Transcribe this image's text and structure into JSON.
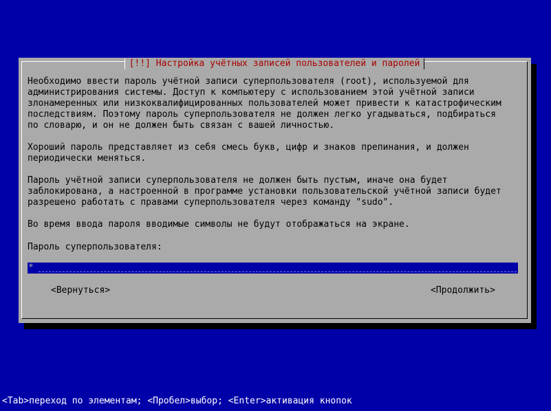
{
  "dialog": {
    "title": "[!!] Настройка учётных записей пользователей и паролей",
    "paragraphs": [
      "Необходимо ввести пароль учётной записи суперпользователя (root), используемой для\nадминистрирования системы. Доступ к компьютеру с использованием этой учётной записи\nзлонамеренных или низкоквалифицированных пользователей может привести к катастрофическим\nпоследствиям. Поэтому пароль суперпользователя не должен легко угадываться, подбираться\nпо словарю, и он не должен быть связан с вашей личностью.",
      "Хороший пароль представляет из себя смесь букв, цифр и знаков препинания, и должен\nпериодически меняться.",
      "Пароль учётной записи суперпользователя не должен быть пустым, иначе она будет\nзаблокирована, а настроенной в программе установки пользовательской учётной записи будет\nразрешено работать с правами суперпользователя через команду \"sudo\".",
      "Во время ввода пароля вводимые символы не будут отображаться на экране."
    ],
    "prompt_label": "Пароль суперпользователя:",
    "input_value": "*",
    "back_button": "<Вернуться>",
    "continue_button": "<Продолжить>"
  },
  "statusbar": {
    "text": "<Tab>переход по элементам; <Пробел>выбор; <Enter>активация кнопок"
  },
  "colors": {
    "background": "#0000a8",
    "dialog": "#aaaaaa",
    "title": "#a80000",
    "input": "#0000a8",
    "status_text": "#ffffff"
  }
}
